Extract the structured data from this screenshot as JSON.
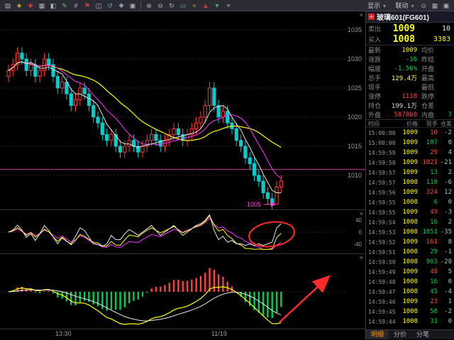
{
  "toolbar": {
    "left_icons": [
      {
        "name": "open-chart-icon",
        "glyph": "▤",
        "color": "#b0b0c0"
      },
      {
        "name": "favorite-icon",
        "glyph": "★",
        "color": "#d2b03a"
      },
      {
        "name": "add-contract-icon",
        "glyph": "✚",
        "color": "#d24040"
      },
      {
        "name": "grid-view-icon",
        "glyph": "▦",
        "color": "#b0b0c0"
      },
      {
        "name": "split-view-icon",
        "glyph": "◧",
        "color": "#b0b0c0"
      },
      {
        "name": "draw-line-icon",
        "glyph": "✎",
        "color": "#60c080"
      },
      {
        "name": "crosshair-icon",
        "glyph": "#",
        "color": "#b0b0c0"
      },
      {
        "name": "flag-icon",
        "glyph": "⚑",
        "color": "#d24040"
      },
      {
        "name": "window-icon",
        "glyph": "◫",
        "color": "#b0b0c0"
      },
      {
        "name": "refresh-icon",
        "glyph": "↺",
        "color": "#60a0d0"
      },
      {
        "name": "indicator-icon",
        "glyph": "❖",
        "color": "#b0b0c0"
      },
      {
        "name": "settings-grid-icon",
        "glyph": "▣",
        "color": "#b0b0c0"
      }
    ],
    "mid_icons": [
      {
        "name": "zoom-in-icon",
        "glyph": "⊕",
        "color": "#b0b0c0"
      },
      {
        "name": "zoom-out-icon",
        "glyph": "⊖",
        "color": "#b0b0c0"
      },
      {
        "name": "undo-icon",
        "glyph": "↻",
        "color": "#b0b0c0"
      },
      {
        "name": "rect-tool-icon",
        "glyph": "▭",
        "color": "#60c080"
      },
      {
        "name": "wave-tool-icon",
        "glyph": "≈",
        "color": "#d2b03a"
      },
      {
        "name": "buy-arrow-icon",
        "glyph": "▲",
        "color": "#d24040"
      },
      {
        "name": "sell-arrow-icon",
        "glyph": "▼",
        "color": "#30b060"
      },
      {
        "name": "target-icon",
        "glyph": "⌖",
        "color": "#b0b0c0"
      }
    ],
    "menus": [
      {
        "name": "display-menu",
        "label": "显示"
      },
      {
        "name": "link-menu",
        "label": "联动"
      }
    ],
    "right_icons": [
      {
        "name": "search-icon",
        "glyph": "⊙",
        "color": "#b0b0c0"
      },
      {
        "name": "layout-icon",
        "glyph": "▦",
        "color": "#b0b0c0"
      },
      {
        "name": "panel-config-icon",
        "glyph": "▣",
        "color": "#b0b0c0"
      }
    ]
  },
  "chart": {
    "price_axis": [
      "1035",
      "1030",
      "1025",
      "1020",
      "1015",
      "1010"
    ],
    "price_axis_values": [
      1035,
      1030,
      1025,
      1020,
      1015,
      1010
    ],
    "osc_axis": [
      "40",
      "0",
      "-40"
    ],
    "osc_axis_values": [
      40,
      0,
      -40
    ],
    "x_labels": [
      {
        "text": "13:30"
      },
      {
        "text": "11/19"
      }
    ],
    "price_marker": "1005",
    "settle_line_price": 1011,
    "close_icon_glyph": "×"
  },
  "chart_data": {
    "type": "candlestick",
    "symbol": "玻璃601(FG601)",
    "ylim": [
      1003,
      1036
    ],
    "y_ticks": [
      1035,
      1030,
      1025,
      1020,
      1015,
      1010
    ],
    "ma_periods": [
      5,
      10,
      20
    ],
    "sub_indicators": [
      "oscillator",
      "macd"
    ],
    "annotations": [
      {
        "type": "ellipse",
        "panel": "oscillator",
        "color": "#ff2b2b",
        "meaning": "hand-drawn circle on recent values"
      },
      {
        "type": "arrow",
        "panel": "macd",
        "color": "#ff2b2b",
        "direction": "up-right"
      },
      {
        "type": "price-label",
        "panel": "main",
        "text": "1005",
        "color": "#ff4bd8"
      }
    ],
    "candles": [
      [
        1027,
        1029,
        1026,
        1028
      ],
      [
        1028,
        1030,
        1027,
        1029
      ],
      [
        1029,
        1032,
        1028,
        1031
      ],
      [
        1031,
        1032,
        1029,
        1030
      ],
      [
        1030,
        1031,
        1027,
        1028
      ],
      [
        1028,
        1030,
        1027,
        1029
      ],
      [
        1029,
        1030,
        1026,
        1027
      ],
      [
        1027,
        1029,
        1026,
        1028
      ],
      [
        1028,
        1031,
        1027,
        1030
      ],
      [
        1030,
        1031,
        1028,
        1029
      ],
      [
        1029,
        1030,
        1026,
        1027
      ],
      [
        1027,
        1028,
        1024,
        1025
      ],
      [
        1025,
        1027,
        1024,
        1026
      ],
      [
        1026,
        1027,
        1023,
        1024
      ],
      [
        1024,
        1025,
        1021,
        1022
      ],
      [
        1022,
        1024,
        1021,
        1023
      ],
      [
        1023,
        1026,
        1022,
        1025
      ],
      [
        1025,
        1026,
        1023,
        1024
      ],
      [
        1024,
        1025,
        1021,
        1022
      ],
      [
        1022,
        1023,
        1019,
        1020
      ],
      [
        1020,
        1021,
        1018,
        1019
      ],
      [
        1019,
        1020,
        1016,
        1017
      ],
      [
        1017,
        1018,
        1015,
        1016
      ],
      [
        1016,
        1018,
        1015,
        1017
      ],
      [
        1017,
        1018,
        1014,
        1015
      ],
      [
        1015,
        1016,
        1013,
        1014
      ],
      [
        1014,
        1016,
        1013,
        1015
      ],
      [
        1015,
        1017,
        1014,
        1016
      ],
      [
        1016,
        1017,
        1014,
        1015
      ],
      [
        1015,
        1016,
        1013,
        1014
      ],
      [
        1014,
        1016,
        1013,
        1015
      ],
      [
        1015,
        1017,
        1014,
        1016
      ],
      [
        1016,
        1018,
        1015,
        1017
      ],
      [
        1017,
        1018,
        1015,
        1016
      ],
      [
        1016,
        1017,
        1014,
        1015
      ],
      [
        1015,
        1017,
        1014,
        1016
      ],
      [
        1016,
        1018,
        1015,
        1017
      ],
      [
        1017,
        1019,
        1016,
        1018
      ],
      [
        1018,
        1019,
        1016,
        1017
      ],
      [
        1017,
        1018,
        1015,
        1016
      ],
      [
        1016,
        1018,
        1015,
        1017
      ],
      [
        1017,
        1019,
        1016,
        1018
      ],
      [
        1018,
        1020,
        1017,
        1019
      ],
      [
        1019,
        1021,
        1018,
        1020
      ],
      [
        1020,
        1023,
        1019,
        1022
      ],
      [
        1022,
        1026,
        1021,
        1025
      ],
      [
        1025,
        1026,
        1021,
        1022
      ],
      [
        1022,
        1023,
        1019,
        1020
      ],
      [
        1020,
        1022,
        1019,
        1021
      ],
      [
        1021,
        1022,
        1018,
        1019
      ],
      [
        1019,
        1020,
        1017,
        1018
      ],
      [
        1018,
        1019,
        1015,
        1016
      ],
      [
        1016,
        1017,
        1014,
        1015
      ],
      [
        1015,
        1016,
        1012,
        1013
      ],
      [
        1013,
        1014,
        1011,
        1012
      ],
      [
        1012,
        1013,
        1009,
        1010
      ],
      [
        1010,
        1011,
        1008,
        1009
      ],
      [
        1009,
        1010,
        1006,
        1007
      ],
      [
        1007,
        1008,
        1005,
        1006
      ],
      [
        1006,
        1007,
        1004,
        1005
      ],
      [
        1005,
        1009,
        1005,
        1008
      ],
      [
        1008,
        1010,
        1007,
        1009
      ]
    ]
  },
  "quote": {
    "title": "玻璃601(FG601)",
    "contract_icon": "＋",
    "ask": {
      "label": "卖出",
      "price": "1009",
      "qty": "10"
    },
    "bid": {
      "label": "买入",
      "price": "1008",
      "qty": "3383"
    },
    "stats": [
      {
        "label": "最新",
        "value": "1009",
        "color": "#ffff00",
        "label2": "均价",
        "value2": "",
        "color2": "#cccccc"
      },
      {
        "label": "涨跌",
        "value": "-16",
        "color": "#00dd55",
        "label2": "昨结",
        "value2": "",
        "color2": "#cccccc"
      },
      {
        "label": "幅度",
        "value": "-1.56%",
        "color": "#00dd55",
        "label2": "开盘",
        "value2": "",
        "color2": "#cccccc"
      },
      {
        "label": "总手",
        "value": "129.4万",
        "color": "#ffff66",
        "label2": "最高",
        "value2": "",
        "color2": "#cccccc"
      },
      {
        "label": "现手",
        "value": "",
        "color": "#ffffff",
        "label2": "最低",
        "value2": "",
        "color2": "#cccccc"
      },
      {
        "label": "涨停",
        "value": "1118",
        "color": "#ff4444",
        "label2": "跌停",
        "value2": "",
        "color2": "#00dd55"
      },
      {
        "label": "持仓",
        "value": "199.1万",
        "color": "#dddddd",
        "label2": "仓差",
        "value2": "",
        "color2": "#cccccc"
      },
      {
        "label": "外盘",
        "value": "587860",
        "color": "#ff4444",
        "label2": "内盘",
        "value2": "7",
        "color2": "#00dd55"
      }
    ],
    "ts_header": [
      "时间",
      "价格",
      "现手",
      "仓差"
    ],
    "ticks": [
      {
        "time": "15:00:00",
        "price": "1009",
        "vol": "10",
        "side": "r",
        "diff": "-2"
      },
      {
        "time": "15:00:00",
        "price": "1009",
        "vol": "107",
        "side": "g",
        "diff": "0"
      },
      {
        "time": "14:59:59",
        "price": "1009",
        "vol": "29",
        "side": "r",
        "diff": "4"
      },
      {
        "time": "14:59:58",
        "price": "1009",
        "vol": "1021",
        "side": "r",
        "diff": "-21"
      },
      {
        "time": "14:59:57",
        "price": "1009",
        "vol": "13",
        "side": "g",
        "diff": "2"
      },
      {
        "time": "14:59:57",
        "price": "1008",
        "vol": "110",
        "side": "g",
        "diff": "-6"
      },
      {
        "time": "14:59:56",
        "price": "1009",
        "vol": "324",
        "side": "r",
        "diff": "12"
      },
      {
        "time": "14:59:55",
        "price": "1008",
        "vol": "6",
        "side": "g",
        "diff": "0"
      },
      {
        "time": "14:59:55",
        "price": "1009",
        "vol": "49",
        "side": "r",
        "diff": "-3"
      },
      {
        "time": "14:59:54",
        "price": "1008",
        "vol": "16",
        "side": "g",
        "diff": "2"
      },
      {
        "time": "14:59:53",
        "price": "1008",
        "vol": "1051",
        "side": "g",
        "diff": "-35"
      },
      {
        "time": "14:59:52",
        "price": "1009",
        "vol": "161",
        "side": "r",
        "diff": "8"
      },
      {
        "time": "14:59:51",
        "price": "1008",
        "vol": "29",
        "side": "g",
        "diff": "-1"
      },
      {
        "time": "14:59:50",
        "price": "1008",
        "vol": "963",
        "side": "g",
        "diff": "-28"
      },
      {
        "time": "14:59:49",
        "price": "1009",
        "vol": "48",
        "side": "r",
        "diff": "5"
      },
      {
        "time": "14:59:48",
        "price": "1008",
        "vol": "16",
        "side": "g",
        "diff": "0"
      },
      {
        "time": "14:59:47",
        "price": "1008",
        "vol": "45",
        "side": "g",
        "diff": "-4"
      },
      {
        "time": "14:59:46",
        "price": "1009",
        "vol": "23",
        "side": "r",
        "diff": "1"
      },
      {
        "time": "14:59:45",
        "price": "1008",
        "vol": "58",
        "side": "g",
        "diff": "-2"
      },
      {
        "time": "14:59:44",
        "price": "1008",
        "vol": "31",
        "side": "g",
        "diff": "0"
      }
    ],
    "tabs": [
      {
        "label": "明细",
        "active": true
      },
      {
        "label": "分价",
        "active": false
      },
      {
        "label": "分笔",
        "active": false
      }
    ]
  }
}
